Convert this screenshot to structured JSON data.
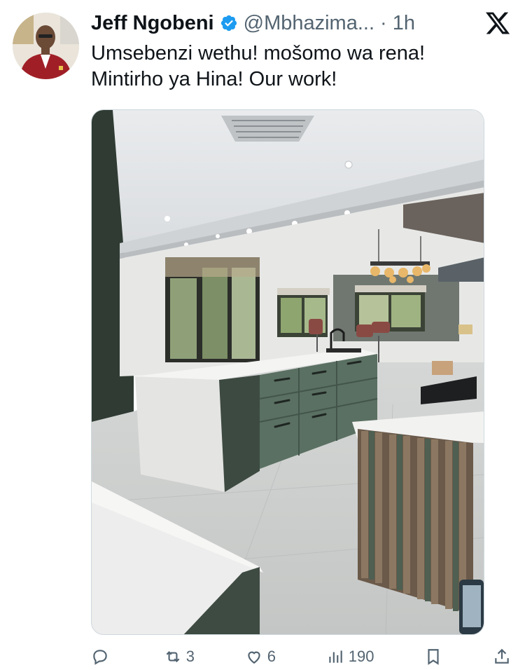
{
  "tweet": {
    "display_name": "Jeff Ngobeni",
    "handle": "@Mbhazima...",
    "separator": "·",
    "time": "1h",
    "text_lines": [
      "Umsebenzi wethu! mošomo wa rena!",
      "Mintirho ya Hina! Our work!"
    ],
    "verified": true
  },
  "icons": {
    "verified": "verified-badge-icon",
    "platform": "x-logo-icon",
    "reply": "reply-icon",
    "retweet": "retweet-icon",
    "like": "heart-icon",
    "views": "views-icon",
    "bookmark": "bookmark-icon",
    "share": "share-icon"
  },
  "actions": {
    "reply_count": "",
    "retweet_count": "3",
    "like_count": "6",
    "views_count": "190"
  },
  "colors": {
    "accent": "#1d9bf0",
    "text": "#0f1419",
    "secondary": "#536471",
    "avatar_jacket": "#9b1c24"
  }
}
